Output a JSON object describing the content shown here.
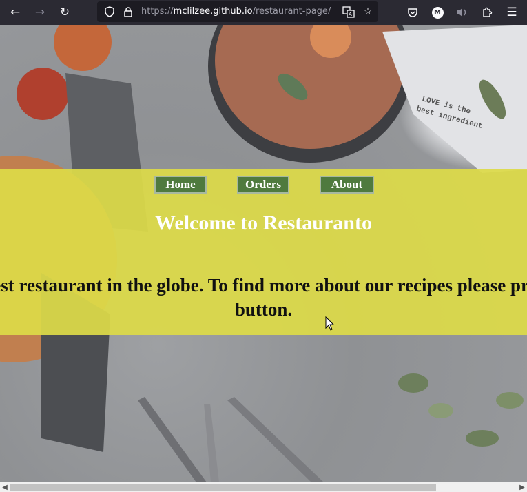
{
  "browser": {
    "url_scheme": "https://",
    "url_host": "mclilzee.github.io",
    "url_path": "/restaurant-page/",
    "icons": [
      "back-arrow-icon",
      "forward-arrow-icon",
      "reload-icon",
      "shield-icon",
      "lock-icon",
      "translate-icon",
      "star-icon",
      "pocket-icon",
      "account-icon",
      "speaker-icon",
      "extensions-icon",
      "menu-icon"
    ],
    "account_initial": "M"
  },
  "nav": {
    "home_label": "Home",
    "orders_label": "Orders",
    "about_label": "About"
  },
  "hero": {
    "title": "Welcome to Restauranto",
    "text": "This is the finest restaurant in the globe. To find more about our recipes please press the Orders button."
  },
  "background_text": "LOVE is the best ingredient",
  "colors": {
    "banner": "#dddA48",
    "nav_button": "#4f7a3e",
    "title_text": "#ffffff"
  }
}
